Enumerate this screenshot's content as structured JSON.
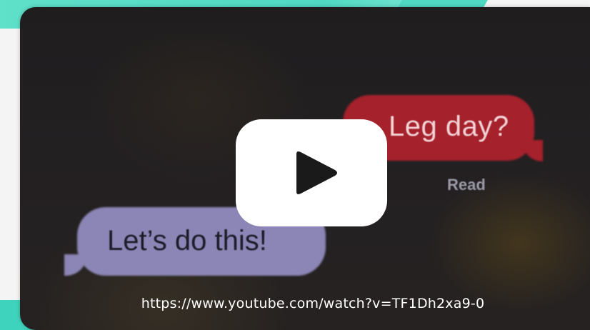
{
  "video": {
    "url": "https://www.youtube.com/watch?v=TF1Dh2xa9-0",
    "play_icon": "play-icon"
  },
  "thumbnail": {
    "red_bubble_text": "Leg day?",
    "read_label": "Read",
    "purple_bubble_text": "Let’s do this!"
  },
  "colors": {
    "teal_accent": "#4fd9c3",
    "red_bubble": "#a5212c",
    "purple_bubble": "#8b86b5",
    "play_button": "#ffffff"
  }
}
